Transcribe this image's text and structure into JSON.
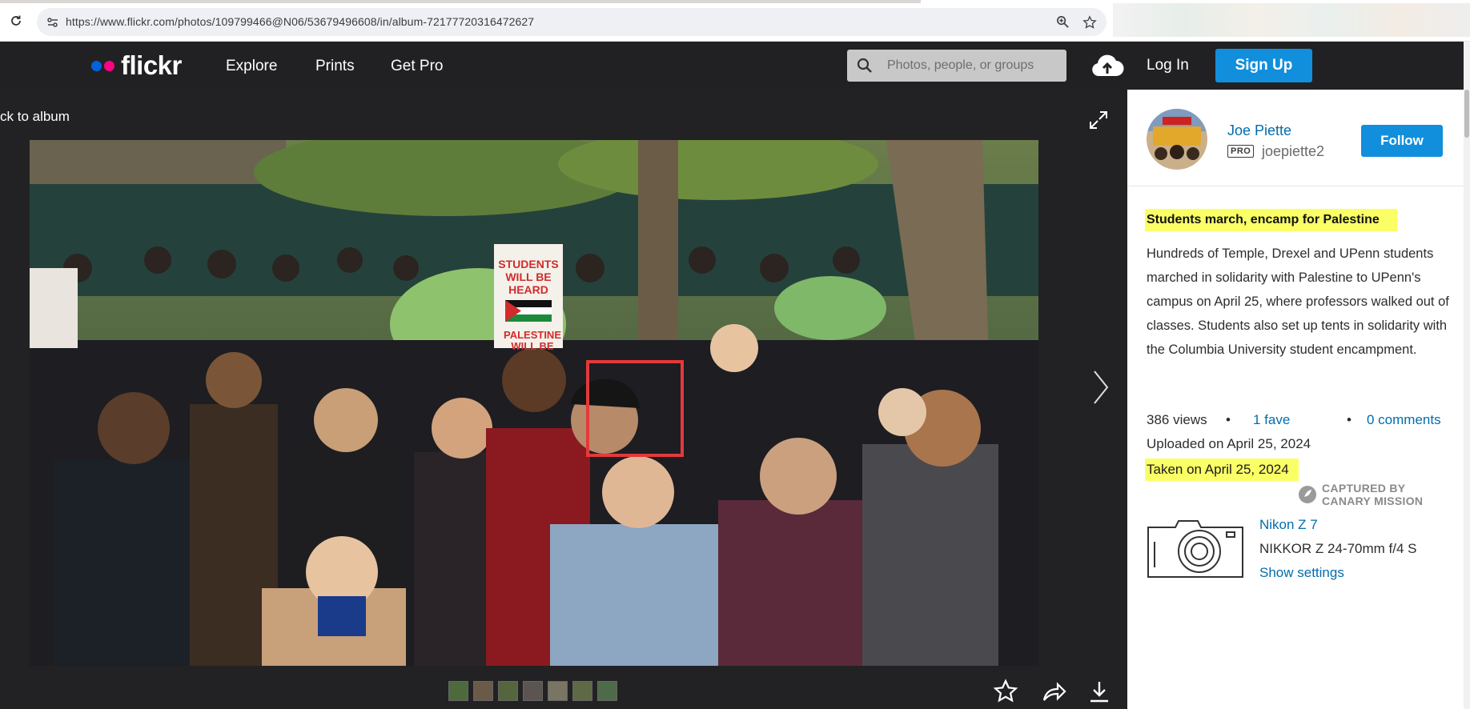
{
  "browser": {
    "url": "https://www.flickr.com/photos/109799466@N06/53679496608/in/album-72177720316472627"
  },
  "header": {
    "logo_text": "flickr",
    "nav": [
      "Explore",
      "Prints",
      "Get Pro"
    ],
    "search_placeholder": "Photos, people, or groups",
    "login_label": "Log In",
    "signup_label": "Sign Up",
    "colors": {
      "bar": "#212124",
      "accent": "#128fdc",
      "logo_blue": "#0063dc",
      "logo_pink": "#ff0084"
    }
  },
  "photo_view": {
    "back_label": "ck to album",
    "thumbnail_count": 7,
    "icons": [
      "expand-icon",
      "next-arrow-icon",
      "fave-star-icon",
      "share-icon",
      "download-icon"
    ],
    "photo_sign_text": [
      "STUDENTS",
      "WILL BE",
      "HEARD",
      "PALESTINE",
      "WILL BE"
    ]
  },
  "owner": {
    "name": "Joe Piette",
    "badge": "PRO",
    "username": "joepiette2",
    "follow_label": "Follow"
  },
  "photo_info": {
    "title": "Students march, encamp for Palestine",
    "description": "Hundreds of Temple, Drexel and UPenn students marched in solidarity with Palestine to UPenn's campus on April 25, where professors walked out of classes. Students also set up tents in solidarity with the Columbia University student encampment.",
    "views": "386 views",
    "faves": "1 fave",
    "comments": "0 comments",
    "bullet": "•",
    "uploaded": "Uploaded on April 25, 2024",
    "taken": "Taken on April 25, 2024",
    "captured_line1": "CAPTURED BY",
    "captured_line2": "CANARY MISSION",
    "camera": "Nikon Z 7",
    "lens": "NIKKOR Z 24-70mm f/4 S",
    "settings_label": "Show settings",
    "highlight_color": "#fbff66"
  }
}
